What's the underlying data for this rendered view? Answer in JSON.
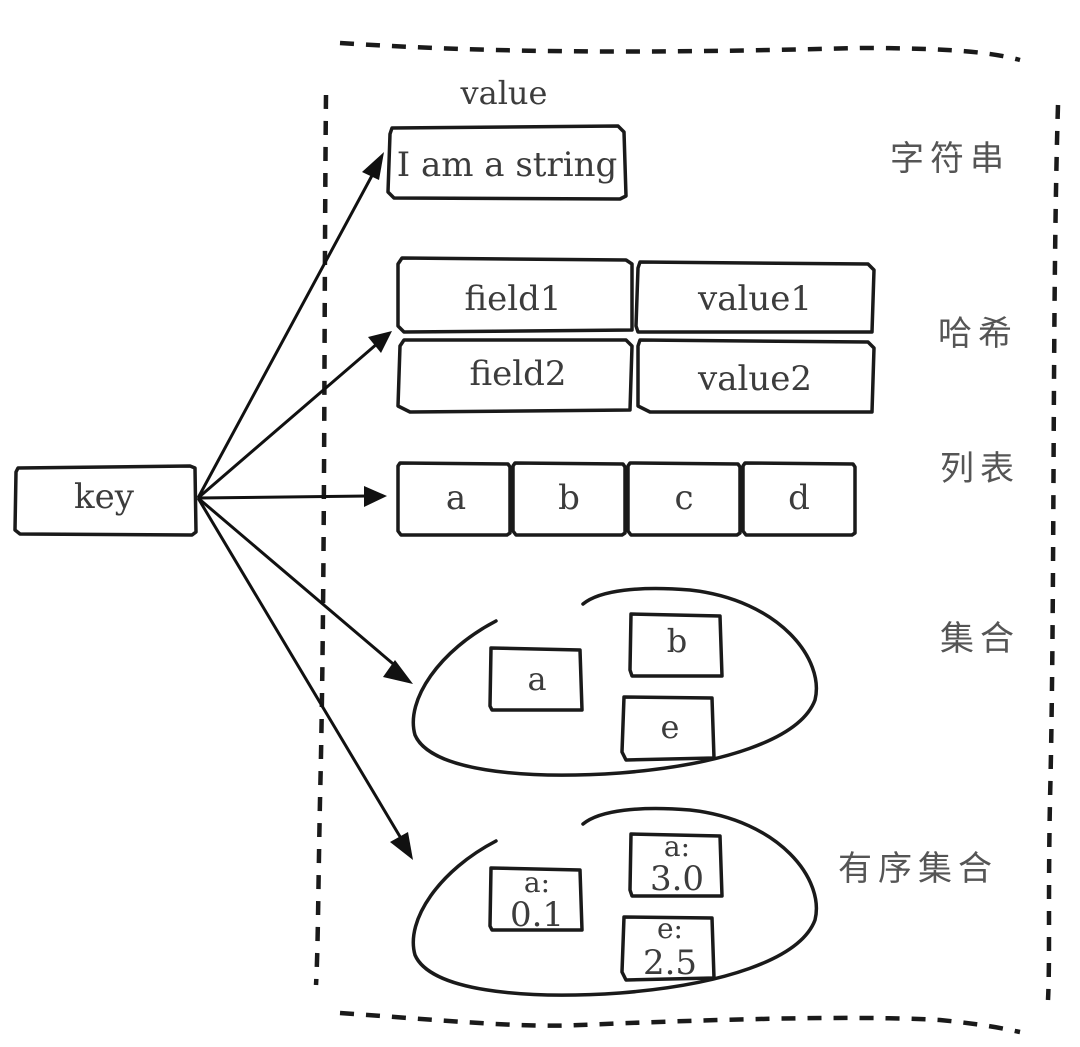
{
  "diagram": {
    "key_label": "key",
    "value_heading": "value",
    "types": {
      "string": {
        "label": "字符串",
        "value": "I am a string"
      },
      "hash": {
        "label": "哈希",
        "rows": [
          {
            "field": "field1",
            "value": "value1"
          },
          {
            "field": "field2",
            "value": "value2"
          }
        ]
      },
      "list": {
        "label": "列表",
        "items": [
          "a",
          "b",
          "c",
          "d"
        ]
      },
      "set": {
        "label": "集合",
        "members": [
          "a",
          "b",
          "e"
        ]
      },
      "zset": {
        "label": "有序集合",
        "members": [
          {
            "member": "a:",
            "score": "0.1"
          },
          {
            "member": "a:",
            "score": "3.0"
          },
          {
            "member": "e:",
            "score": "2.5"
          }
        ]
      }
    },
    "colors": {
      "ink": "#1a1a1a",
      "text": "#3c3c3c",
      "label": "#555555",
      "background": "#ffffff"
    }
  }
}
